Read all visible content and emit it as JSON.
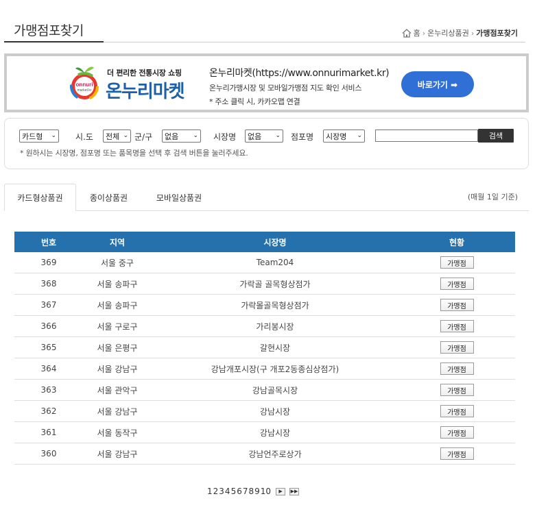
{
  "header": {
    "title": "가맹점포찾기",
    "breadcrumb": [
      "홈",
      "온누리상품권",
      "가맹점포찾기"
    ]
  },
  "banner": {
    "logo_badge": "onnuri market.kr",
    "tagline": "더 편리한 전통시장 쇼핑",
    "logo_name": "온누리마켓",
    "url_text": "온누리마켓(https://www.onnurimarket.kr)",
    "desc": "온누리가맹시장 및 모바일가맹점 지도 확인 서비스",
    "note": "* 주소 클릭 시, 카카오맵 연결",
    "button_label": "바로가기 ➡",
    "button_color": "#2f6fd6"
  },
  "search": {
    "card_type_value": "카드형",
    "sido_label": "시.도",
    "sido_value": "전체",
    "gungu_label": "군/구",
    "gungu_value": "없음",
    "market_label": "시장명",
    "market_value": "없음",
    "store_label": "점포명",
    "store_value": "시장명",
    "button_label": "검색",
    "help": "* 원하시는 시장명, 점포명 또는 품목명을 선택 후 검색 버튼을 눌러주세요."
  },
  "tabs": {
    "items": [
      {
        "label": "카드형상품권",
        "active": true
      },
      {
        "label": "종이상품권",
        "active": false
      },
      {
        "label": "모바일상품권",
        "active": false
      }
    ],
    "note": "(매월 1일 기준)"
  },
  "table": {
    "header_color": "#2471ad",
    "columns": [
      "번호",
      "지역",
      "시장명",
      "현황"
    ],
    "button_label": "가맹점",
    "rows": [
      {
        "no": "369",
        "region": "서울 중구",
        "market": "Team204"
      },
      {
        "no": "368",
        "region": "서울 송파구",
        "market": "가락골 골목형상점가"
      },
      {
        "no": "367",
        "region": "서울 송파구",
        "market": "가락몰골목형상점가"
      },
      {
        "no": "366",
        "region": "서울 구로구",
        "market": "가리봉시장"
      },
      {
        "no": "365",
        "region": "서울 은평구",
        "market": "갈현시장"
      },
      {
        "no": "364",
        "region": "서울 강남구",
        "market": "강남개포시장(구 개포2동종심상점가)"
      },
      {
        "no": "363",
        "region": "서울 관악구",
        "market": "강남골목시장"
      },
      {
        "no": "362",
        "region": "서울 강남구",
        "market": "강남시장"
      },
      {
        "no": "361",
        "region": "서울 동작구",
        "market": "강남시장"
      },
      {
        "no": "360",
        "region": "서울 강남구",
        "market": "강남언주로상가"
      }
    ]
  },
  "pagination": {
    "pages": [
      "1",
      "2",
      "3",
      "4",
      "5",
      "6",
      "7",
      "8",
      "9",
      "10"
    ],
    "next": "▶",
    "last": "▶▶"
  }
}
